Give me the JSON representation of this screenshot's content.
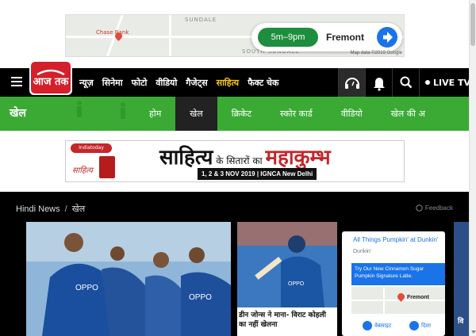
{
  "top_ad": {
    "map_labels": [
      "SUNDALE",
      "Chase Bank",
      "SOUTH SUNDALE"
    ],
    "time_range": "5m–9pm",
    "place": "Fremont",
    "credit": "Map data ©2019 Google"
  },
  "nav": {
    "logo_text": "आज तक",
    "items": [
      "न्यूज़",
      "सिनेमा",
      "फोटो",
      "वीडियो",
      "गैजेट्स",
      "साहित्य",
      "फैक्ट चेक"
    ],
    "active_item_color": "#f5c518",
    "live_label": "LIVE TV"
  },
  "subnav": {
    "title": "खेल",
    "items": [
      "होम",
      "खेल",
      "क्रिकेट",
      "स्कोर कार्ड",
      "वीडियो",
      "खेल की अ"
    ],
    "accent": "#3aaa35"
  },
  "banner": {
    "brand": "Indiatoday",
    "brand_sub": "साहित्य",
    "title_main": "साहित्य",
    "title_small": " के सितारों का ",
    "title_big": "महाकुम्भ",
    "date": "1, 2 & 3 NOV 2019 | IGNCA New Delhi"
  },
  "content": {
    "breadcrumb": [
      "Hindi News",
      "खेल"
    ],
    "feedback": "Feedback",
    "card2_headline": "डीन जोन्स ने माना- विराट कोहली का नहीं खेलना",
    "map_ad": {
      "headline": "All Things Pumpkin' at Dunkin'",
      "brand": "Dunkin'",
      "promo": "Try Our New Cinnamon Sugar Pumpkin Signature Latte.",
      "place": "Fremont",
      "action1": "वेबसाइट",
      "action2": "दिशा"
    },
    "sliver_text": "वि"
  }
}
